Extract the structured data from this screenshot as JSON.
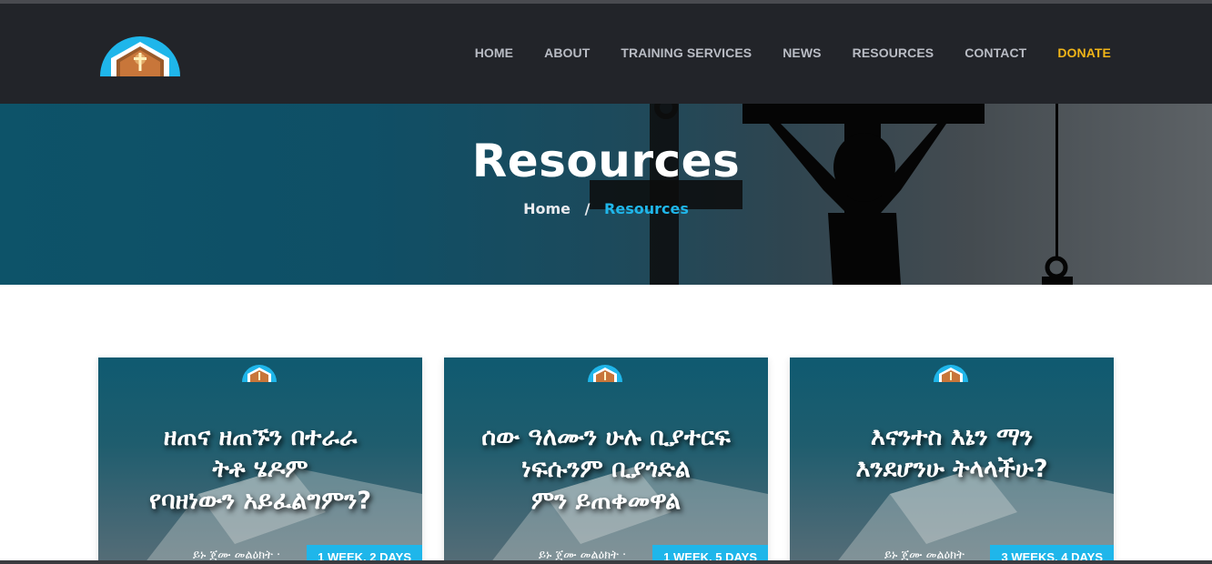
{
  "header": {
    "logo_alt": "church logo",
    "nav": [
      {
        "label": "HOME"
      },
      {
        "label": "ABOUT"
      },
      {
        "label": "TRAINING SERVICES"
      },
      {
        "label": "NEWS"
      },
      {
        "label": "RESOURCES"
      },
      {
        "label": "CONTACT"
      },
      {
        "label": "DONATE"
      }
    ]
  },
  "hero": {
    "title": "Resources",
    "breadcrumb": {
      "home": "Home",
      "separator": "/",
      "current": "Resources"
    }
  },
  "cards": [
    {
      "title": "ዘጠና ዘጠኙን በተራራ\nትቶ ሄዶም\nየባዘነውን አይፈልግምን?",
      "meta": "ይኑ ጀሙ መልዕክት ·",
      "badge": "1 WEEK, 2 DAYS"
    },
    {
      "title": "ሰው ዓለሙን ሁሉ ቢያተርፍ\nነፍሱንም ቢያጎድል\nምን ይጠቀመዋል",
      "meta": "ይኑ ጀሙ መልዕክት ·",
      "badge": "1 WEEK, 5 DAYS"
    },
    {
      "title": "እናንተስ እኔን ማን\nእንደሆንሁ ትላላችሁ?",
      "meta": "ይኑ ጀሙ መልዕክት",
      "badge": "3 WEEKS, 4 DAYS"
    }
  ],
  "colors": {
    "header_bg": "#222429",
    "accent": "#1fb6ea",
    "donate": "#f1b518"
  }
}
